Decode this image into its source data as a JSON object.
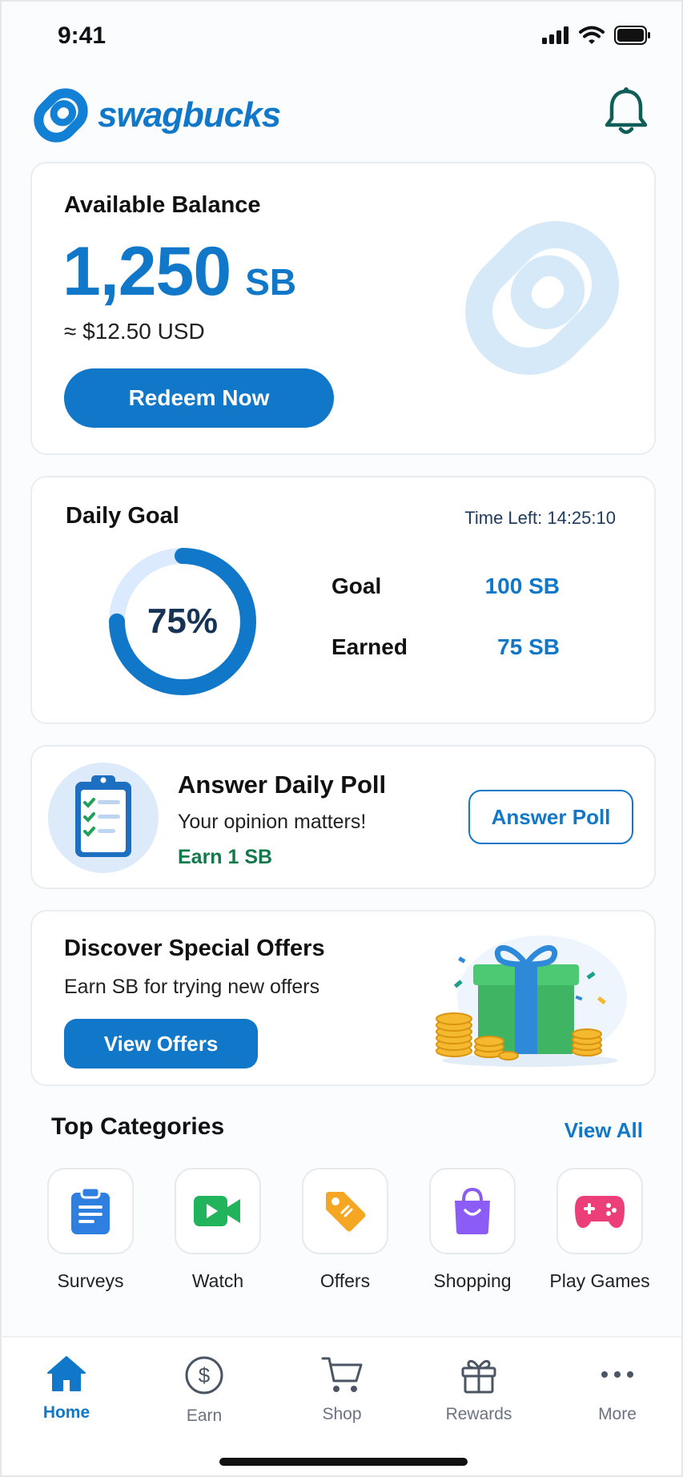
{
  "status_bar": {
    "time": "9:41"
  },
  "header": {
    "logo_text": "swagbucks"
  },
  "balance": {
    "title": "Available Balance",
    "amount": "1,250",
    "unit": "SB",
    "usd": "≈ $12.50 USD",
    "redeem_label": "Redeem Now"
  },
  "daily_goal": {
    "title": "Daily Goal",
    "time_left": "Time Left: 14:25:10",
    "percent_label": "75%",
    "progress": 0.75,
    "goal_label": "Goal",
    "goal_value": "100 SB",
    "earned_label": "Earned",
    "earned_value": "75 SB"
  },
  "poll": {
    "title": "Answer Daily Poll",
    "subtitle": "Your opinion matters!",
    "reward": "Earn 1 SB",
    "button_label": "Answer Poll"
  },
  "offers": {
    "title": "Discover Special Offers",
    "subtitle": "Earn SB for trying new offers",
    "button_label": "View Offers"
  },
  "categories": {
    "title": "Top Categories",
    "view_all": "View All",
    "items": [
      {
        "label": "Surveys",
        "icon": "clipboard-icon"
      },
      {
        "label": "Watch",
        "icon": "video-icon"
      },
      {
        "label": "Offers",
        "icon": "tag-icon"
      },
      {
        "label": "Shopping",
        "icon": "shopping-bag-icon"
      },
      {
        "label": "Play Games",
        "icon": "gamepad-icon"
      }
    ]
  },
  "bottom_nav": {
    "items": [
      {
        "label": "Home",
        "icon": "home-icon",
        "active": true
      },
      {
        "label": "Earn",
        "icon": "dollar-icon",
        "active": false
      },
      {
        "label": "Shop",
        "icon": "cart-icon",
        "active": false
      },
      {
        "label": "Rewards",
        "icon": "gift-icon",
        "active": false
      },
      {
        "label": "More",
        "icon": "more-icon",
        "active": false
      }
    ]
  },
  "colors": {
    "brand": "#1077c9",
    "success": "#127a4a",
    "ring_track": "#dbeafe"
  }
}
